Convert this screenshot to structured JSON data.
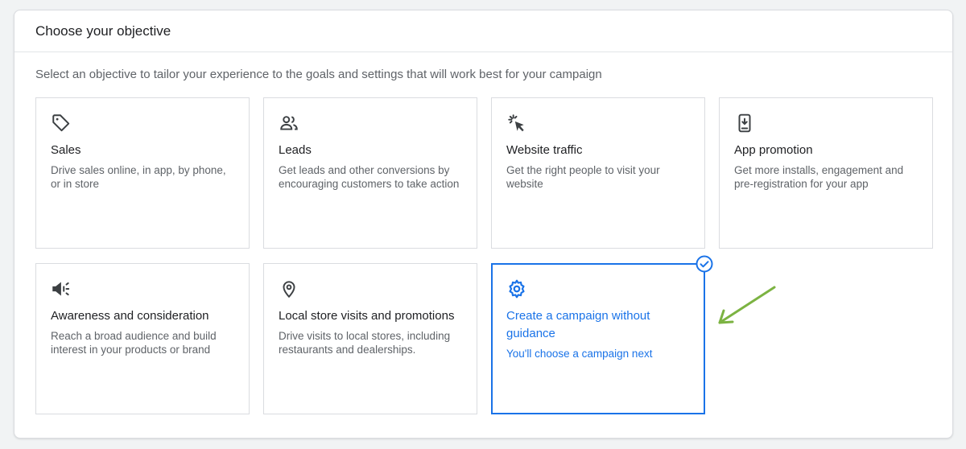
{
  "panel": {
    "title": "Choose your objective",
    "intro": "Select an objective to tailor your experience to the goals and settings that will work best for your campaign"
  },
  "cards": [
    {
      "id": "sales",
      "icon": "tag-icon",
      "title": "Sales",
      "description": "Drive sales online, in app, by phone, or in store",
      "selected": false
    },
    {
      "id": "leads",
      "icon": "people-icon",
      "title": "Leads",
      "description": "Get leads and other conversions by encouraging customers to take action",
      "selected": false
    },
    {
      "id": "website-traffic",
      "icon": "cursor-click-icon",
      "title": "Website traffic",
      "description": "Get the right people to visit your website",
      "selected": false
    },
    {
      "id": "app-promotion",
      "icon": "phone-download-icon",
      "title": "App promotion",
      "description": "Get more installs, engagement and pre-registration for your app",
      "selected": false
    },
    {
      "id": "awareness",
      "icon": "megaphone-icon",
      "title": "Awareness and consideration",
      "description": "Reach a broad audience and build interest in your products or brand",
      "selected": false
    },
    {
      "id": "local-store",
      "icon": "location-pin-icon",
      "title": "Local store visits and promotions",
      "description": "Drive visits to local stores, including restaurants and dealerships.",
      "selected": false
    },
    {
      "id": "no-guidance",
      "icon": "gear-icon",
      "title": "Create a campaign without guidance",
      "description": "You'll choose a campaign next",
      "selected": true
    }
  ],
  "colors": {
    "accent": "#1a73e8",
    "annotation_arrow": "#7cb342"
  }
}
